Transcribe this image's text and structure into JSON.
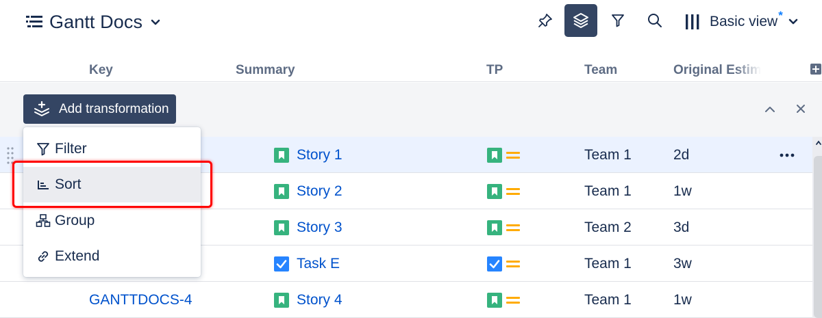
{
  "app": {
    "title": "Gantt Docs",
    "icon": "list-lines-icon"
  },
  "toolbar": {
    "pin_icon": "pin-icon",
    "transform_icon": "layers-icon",
    "filter_icon": "filter-icon",
    "search_icon": "search-icon",
    "view": {
      "label": "Basic view",
      "modified_marker": "*",
      "icon": "columns-icon"
    }
  },
  "columns": [
    {
      "label": "Key"
    },
    {
      "label": "Summary"
    },
    {
      "label": "TP"
    },
    {
      "label": "Team"
    },
    {
      "label": "Original Estim"
    }
  ],
  "transformation_bar": {
    "add_label": "Add transformation"
  },
  "menu": {
    "items": [
      {
        "label": "Filter",
        "icon": "filter-icon"
      },
      {
        "label": "Sort",
        "icon": "sort-icon"
      },
      {
        "label": "Group",
        "icon": "group-icon"
      },
      {
        "label": "Extend",
        "icon": "link-icon"
      }
    ],
    "highlighted": "Sort"
  },
  "rows": [
    {
      "key": "",
      "summary": "Story 1",
      "type": "story",
      "team": "Team 1",
      "estimate": "2d",
      "selected": true
    },
    {
      "key": "",
      "summary": "Story 2",
      "type": "story",
      "team": "Team 1",
      "estimate": "1w",
      "selected": false
    },
    {
      "key": "",
      "summary": "Story 3",
      "type": "story",
      "team": "Team 2",
      "estimate": "3d",
      "selected": false
    },
    {
      "key": "",
      "summary": "Task E",
      "type": "task",
      "team": "Team 1",
      "estimate": "3w",
      "selected": false
    },
    {
      "key": "GANTTDOCS-4",
      "summary": "Story 4",
      "type": "story",
      "team": "Team 1",
      "estimate": "1w",
      "selected": false
    }
  ],
  "colors": {
    "primary_dark": "#344563",
    "link": "#0052cc",
    "story_green": "#36b37e",
    "task_blue": "#2684ff",
    "priority_orange": "#ffab00",
    "highlight_red": "#ff0000"
  }
}
